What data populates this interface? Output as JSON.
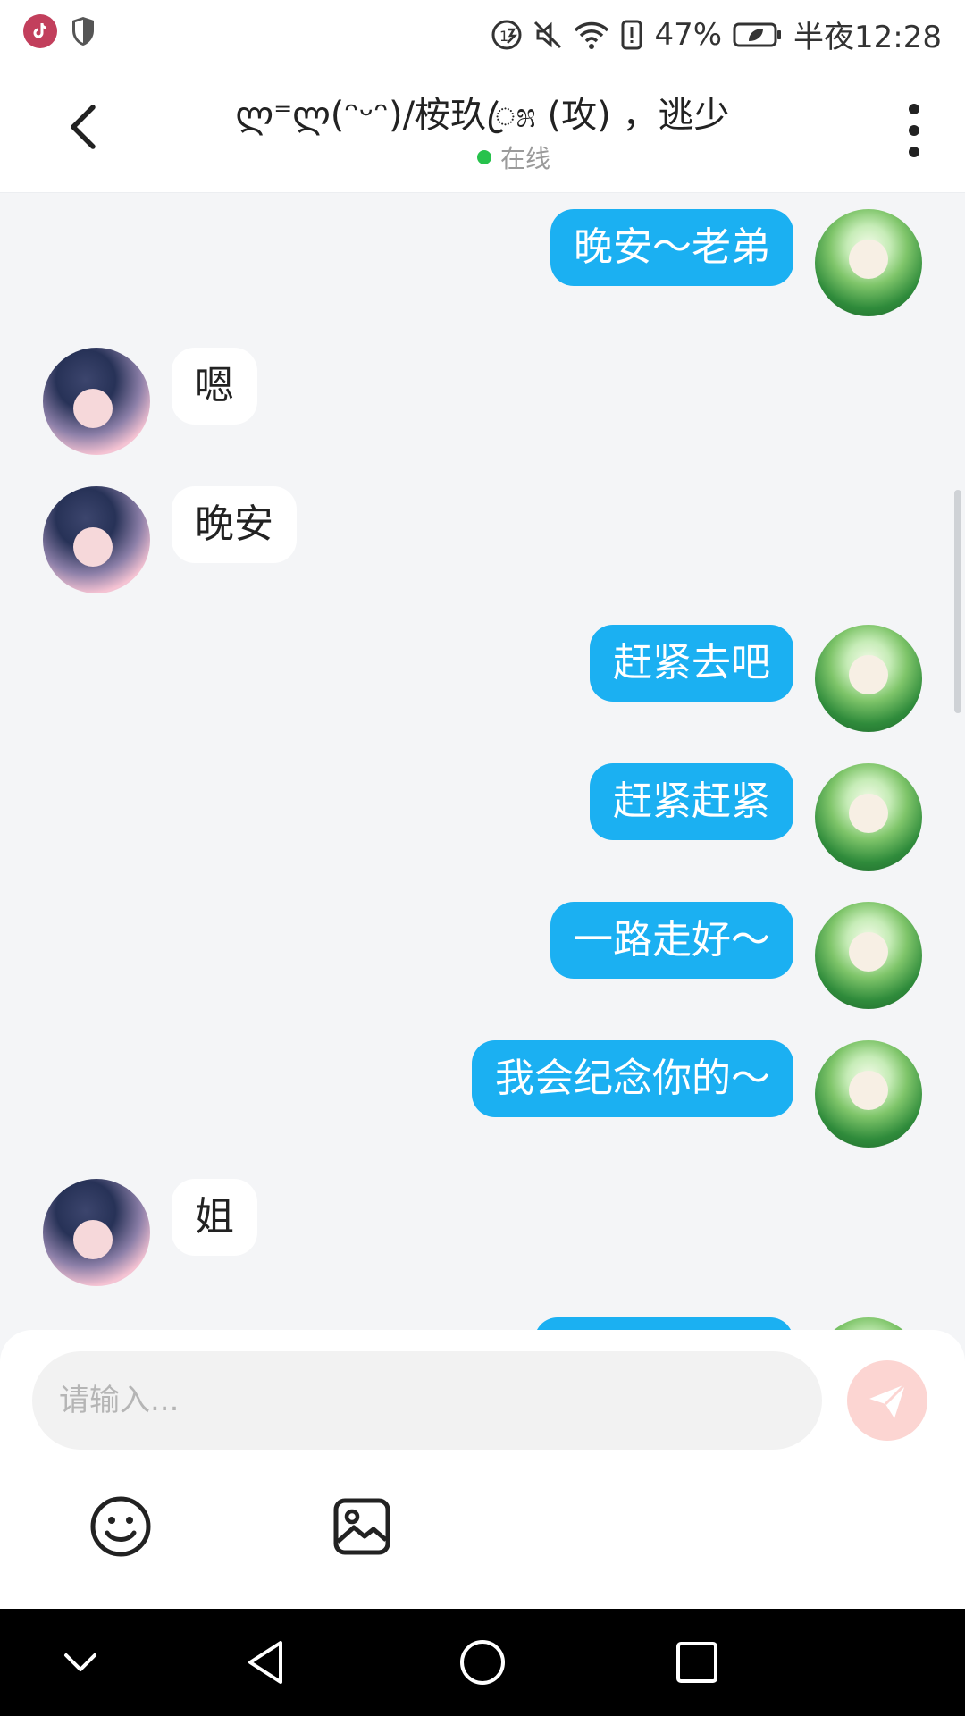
{
  "status_bar": {
    "battery_percent": "47%",
    "time": "半夜12:28",
    "icons": [
      "tiktok-app-icon",
      "shield-icon",
      "hd-call-icon",
      "mute-icon",
      "wifi-icon",
      "alert-icon",
      "battery-icon"
    ]
  },
  "header": {
    "title": "ლ⁼ლ(ᵔᵕᵔ)/桉玖ꦿ೫ (攻) ，逃少",
    "status": "在线"
  },
  "messages": [
    {
      "side": "out",
      "text": "晚安～老弟"
    },
    {
      "side": "in",
      "text": "嗯"
    },
    {
      "side": "in",
      "text": "晚安"
    },
    {
      "side": "out",
      "text": "赶紧去吧"
    },
    {
      "side": "out",
      "text": "赶紧赶紧"
    },
    {
      "side": "out",
      "text": "一路走好～"
    },
    {
      "side": "out",
      "text": "我会纪念你的～"
    },
    {
      "side": "in",
      "text": "姐"
    },
    {
      "side": "out",
      "text": ""
    }
  ],
  "input": {
    "placeholder": "请输入..."
  },
  "colors": {
    "outgoing_bubble": "#1bb0f2",
    "incoming_bubble": "#ffffff",
    "chat_background": "#f4f5f7",
    "send_button": "#fcd5d2",
    "online_dot": "#27c24c"
  },
  "nav": [
    "collapse-icon",
    "back-icon",
    "home-icon",
    "recents-icon"
  ]
}
